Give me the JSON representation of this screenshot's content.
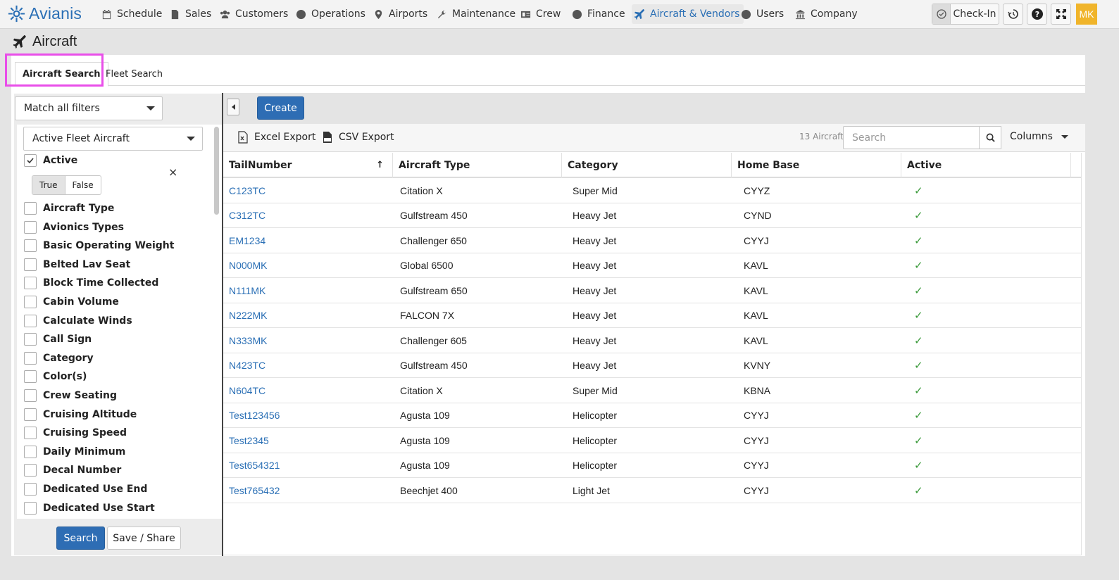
{
  "brand": {
    "name": "Avianis"
  },
  "nav": [
    {
      "label": "Schedule",
      "icon": "calendar-icon"
    },
    {
      "label": "Sales",
      "icon": "document-icon"
    },
    {
      "label": "Customers",
      "icon": "users-icon"
    },
    {
      "label": "Operations",
      "icon": "globe-icon"
    },
    {
      "label": "Airports",
      "icon": "map-pin-icon"
    },
    {
      "label": "Maintenance",
      "icon": "wrench-icon"
    },
    {
      "label": "Crew",
      "icon": "id-card-icon"
    },
    {
      "label": "Finance",
      "icon": "dollar-icon"
    },
    {
      "label": "Aircraft & Vendors",
      "icon": "plane-icon"
    },
    {
      "label": "Users",
      "icon": "user-icon"
    },
    {
      "label": "Company",
      "icon": "bank-icon"
    }
  ],
  "tools": {
    "checkin_label": "Check-In",
    "avatar_initials": "MK"
  },
  "page": {
    "title": "Aircraft"
  },
  "tabs": [
    {
      "label": "Aircraft Search"
    },
    {
      "label": "Fleet Search"
    }
  ],
  "filters": {
    "match_mode": "Match all filters",
    "preset": "Active Fleet Aircraft",
    "active_filter": {
      "label": "Active",
      "true_label": "True",
      "false_label": "False",
      "remove": "×"
    },
    "items": [
      "Aircraft Type",
      "Avionics Types",
      "Basic Operating Weight",
      "Belted Lav Seat",
      "Block Time Collected",
      "Cabin Volume",
      "Calculate Winds",
      "Call Sign",
      "Category",
      "Color(s)",
      "Crew Seating",
      "Cruising Altitude",
      "Cruising Speed",
      "Daily Minimum",
      "Decal Number",
      "Dedicated Use End",
      "Dedicated Use Start"
    ],
    "search_label": "Search",
    "save_label": "Save / Share"
  },
  "toolbar": {
    "create_label": "Create"
  },
  "subbar": {
    "excel_label": "Excel Export",
    "csv_label": "CSV Export",
    "count_label": "13 Aircraft",
    "search_placeholder": "Search",
    "columns_label": "Columns"
  },
  "grid": {
    "columns": [
      "TailNumber",
      "Aircraft Type",
      "Category",
      "Home Base",
      "Active"
    ],
    "sort_indicator": "↑",
    "rows": [
      {
        "tail": "C123TC",
        "type": "Citation X",
        "category": "Super Mid",
        "base": "CYYZ",
        "active": "✓"
      },
      {
        "tail": "C312TC",
        "type": "Gulfstream 450",
        "category": "Heavy Jet",
        "base": "CYND",
        "active": "✓"
      },
      {
        "tail": "EM1234",
        "type": "Challenger 650",
        "category": "Heavy Jet",
        "base": "CYYJ",
        "active": "✓"
      },
      {
        "tail": "N000MK",
        "type": "Global 6500",
        "category": "Heavy Jet",
        "base": "KAVL",
        "active": "✓"
      },
      {
        "tail": "N111MK",
        "type": "Gulfstream 650",
        "category": "Heavy Jet",
        "base": "KAVL",
        "active": "✓"
      },
      {
        "tail": "N222MK",
        "type": "FALCON 7X",
        "category": "Heavy Jet",
        "base": "KAVL",
        "active": "✓"
      },
      {
        "tail": "N333MK",
        "type": "Challenger 605",
        "category": "Heavy Jet",
        "base": "KAVL",
        "active": "✓"
      },
      {
        "tail": "N423TC",
        "type": "Gulfstream 450",
        "category": "Heavy Jet",
        "base": "KVNY",
        "active": "✓"
      },
      {
        "tail": "N604TC",
        "type": "Citation X",
        "category": "Super Mid",
        "base": "KBNA",
        "active": "✓"
      },
      {
        "tail": "Test123456",
        "type": "Agusta 109",
        "category": "Helicopter",
        "base": "CYYJ",
        "active": "✓"
      },
      {
        "tail": "Test2345",
        "type": "Agusta 109",
        "category": "Helicopter",
        "base": "CYYJ",
        "active": "✓"
      },
      {
        "tail": "Test654321",
        "type": "Agusta 109",
        "category": "Helicopter",
        "base": "CYYJ",
        "active": "✓"
      },
      {
        "tail": "Test765432",
        "type": "Beechjet 400",
        "category": "Light Jet",
        "base": "CYYJ",
        "active": "✓"
      }
    ]
  },
  "colors": {
    "brand_blue": "#2a6fb5",
    "check_green": "#3a9a3a",
    "highlight_magenta": "#e94ee9",
    "avatar_yellow": "#f0b42a"
  }
}
